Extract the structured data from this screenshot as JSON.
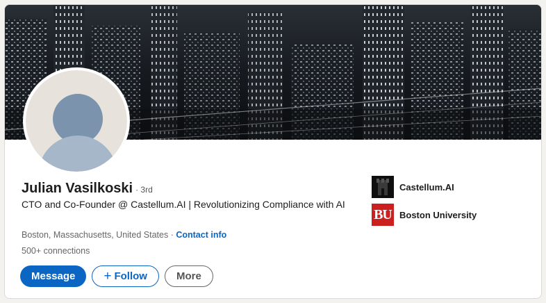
{
  "profile": {
    "name": "Julian Vasilkoski",
    "degree": "· 3rd",
    "headline": "CTO and Co-Founder @ Castellum.AI | Revolutionizing Compliance with AI",
    "location": "Boston, Massachusetts, United States ·",
    "contact_info_label": "Contact info",
    "connections": "500+ connections"
  },
  "actions": {
    "message_label": "Message",
    "follow_plus": "+",
    "follow_label": "Follow",
    "more_label": "More"
  },
  "side": {
    "items": [
      {
        "label": "Castellum.AI",
        "logo": "castellum-logo"
      },
      {
        "label": "Boston University",
        "logo": "bu-logo",
        "logo_text": "BU"
      }
    ]
  },
  "colors": {
    "accent": "#0a66c2",
    "banner": "#14171b",
    "bu_red": "#cc1f1f"
  }
}
